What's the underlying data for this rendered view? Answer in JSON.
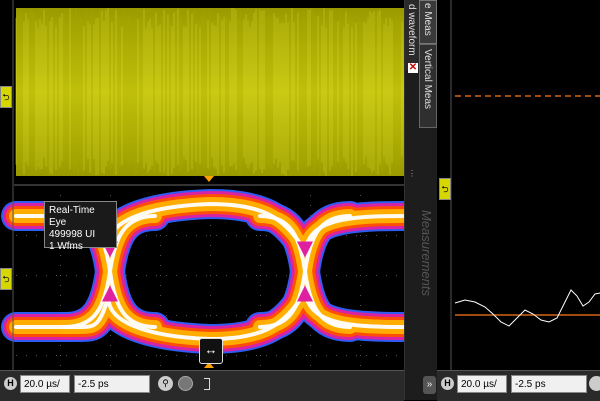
{
  "colors": {
    "waveform": "#b4b400",
    "eye_core": "#ffffff",
    "eye_inner": "#ffb000",
    "eye_mid": "#ff5000",
    "eye_outer": "#e020a0",
    "eye_edge": "#3060ff",
    "trigger_marker": "#ffa000",
    "orange_line": "#ff7a1a"
  },
  "eye_tooltip": {
    "title": "Real-Time Eye",
    "ui_count": "499998 UI",
    "wfms": "1 Wfms"
  },
  "side_panel": {
    "tab_meas": "e Meas",
    "tab_waveform": "d waveform",
    "tab_vertical": "Vertical Meas",
    "measurements_label": "Measurements"
  },
  "left_toolbar": {
    "h_label": "H",
    "time_per_div": "20.0 µs/",
    "offset": "-2.5 ps"
  },
  "right_toolbar": {
    "h_label": "H",
    "time_per_div": "20.0 µs/",
    "offset": "-2.5 ps"
  },
  "icons": {
    "channel_marker": "channel-arrow-icon",
    "close": "close-x-icon",
    "zoom": "zoom-icon",
    "expand": "double-chevron-right-icon",
    "horizontal_arrows": "horizontal-resize-icon"
  }
}
